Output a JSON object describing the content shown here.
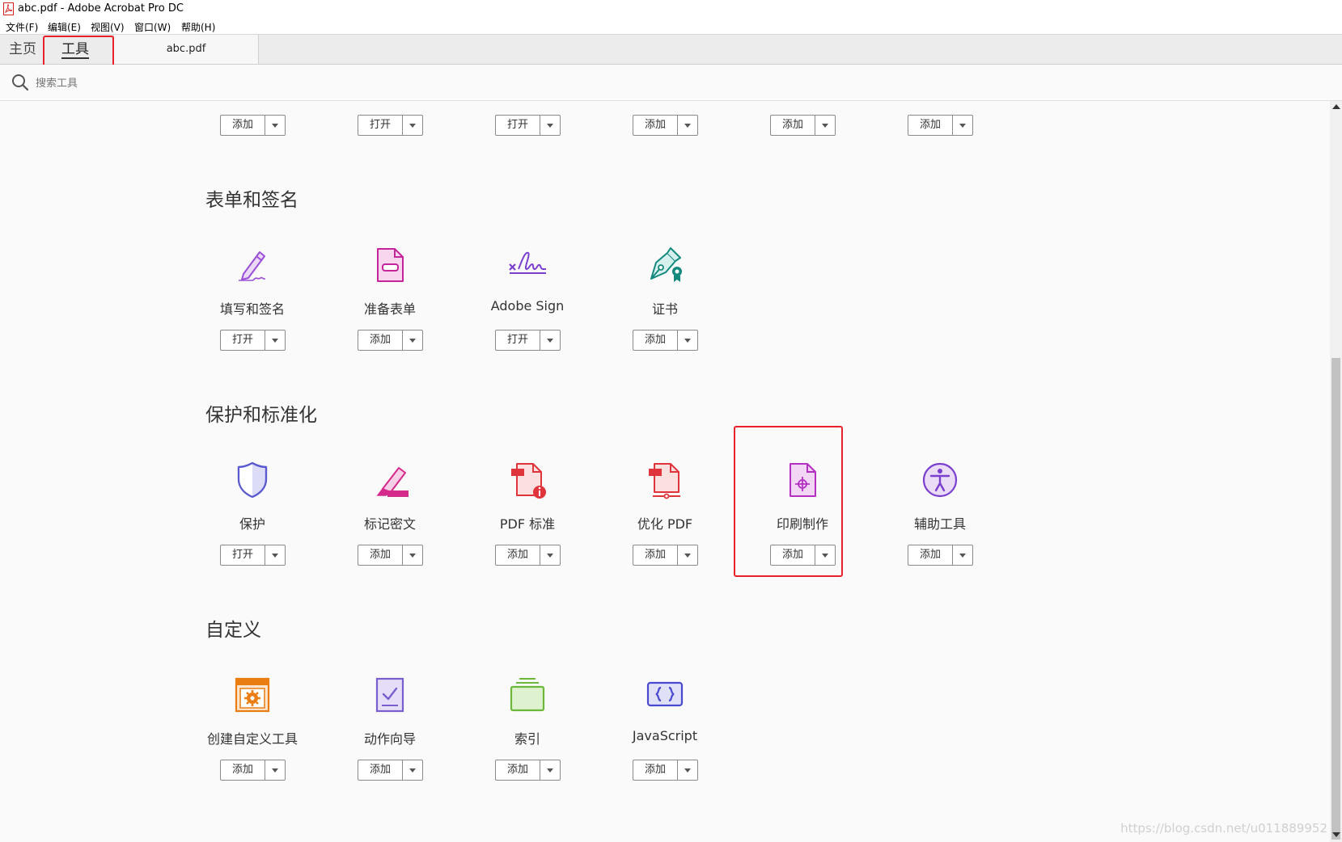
{
  "window": {
    "title": "abc.pdf - Adobe Acrobat Pro DC"
  },
  "menu": [
    "文件(F)",
    "编辑(E)",
    "视图(V)",
    "窗口(W)",
    "帮助(H)"
  ],
  "tabs": {
    "home": "主页",
    "tools": "工具",
    "document": "abc.pdf"
  },
  "search": {
    "placeholder": "搜索工具"
  },
  "top_row_buttons": [
    "添加",
    "打开",
    "打开",
    "添加",
    "添加",
    "添加"
  ],
  "sections": [
    {
      "title": "表单和签名",
      "tools": [
        {
          "label": "填写和签名",
          "button": "打开",
          "icon": "fill-sign-icon"
        },
        {
          "label": "准备表单",
          "button": "添加",
          "icon": "prepare-form-icon"
        },
        {
          "label": "Adobe Sign",
          "button": "打开",
          "icon": "adobe-sign-icon"
        },
        {
          "label": "证书",
          "button": "添加",
          "icon": "certificate-icon"
        }
      ]
    },
    {
      "title": "保护和标准化",
      "tools": [
        {
          "label": "保护",
          "button": "打开",
          "icon": "shield-icon"
        },
        {
          "label": "标记密文",
          "button": "添加",
          "icon": "redact-icon"
        },
        {
          "label": "PDF 标准",
          "button": "添加",
          "icon": "pdf-standards-icon"
        },
        {
          "label": "优化 PDF",
          "button": "添加",
          "icon": "optimize-pdf-icon"
        },
        {
          "label": "印刷制作",
          "button": "添加",
          "icon": "print-production-icon"
        },
        {
          "label": "辅助工具",
          "button": "添加",
          "icon": "accessibility-icon"
        }
      ]
    },
    {
      "title": "自定义",
      "tools": [
        {
          "label": "创建自定义工具",
          "button": "添加",
          "icon": "custom-tool-icon"
        },
        {
          "label": "动作向导",
          "button": "添加",
          "icon": "action-wizard-icon"
        },
        {
          "label": "索引",
          "button": "添加",
          "icon": "index-icon"
        },
        {
          "label": "JavaScript",
          "button": "添加",
          "icon": "javascript-icon"
        }
      ]
    }
  ],
  "watermark": "https://blog.csdn.net/u011889952",
  "colors": {
    "highlight": "#e8222a"
  }
}
